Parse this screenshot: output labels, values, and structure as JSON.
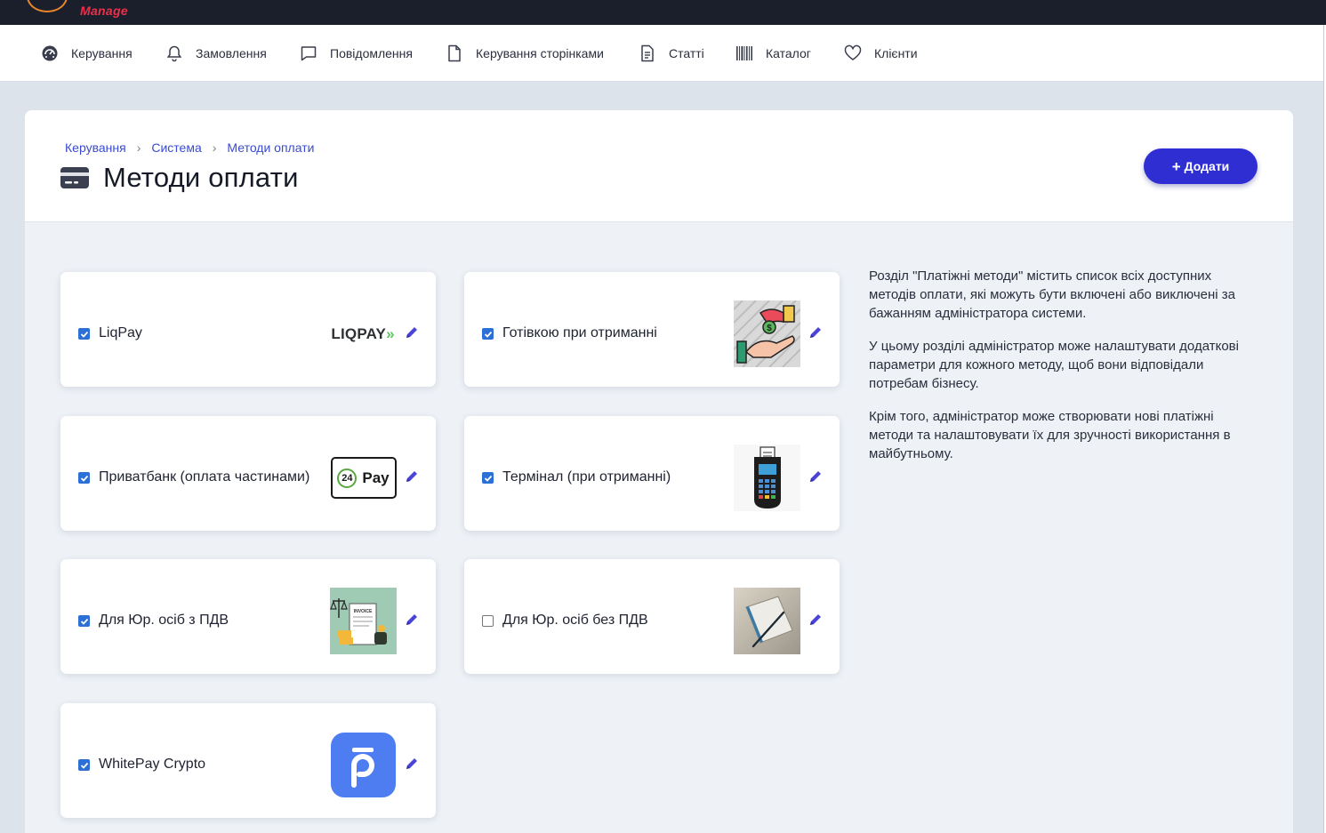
{
  "app": {
    "logo_text": "Manage"
  },
  "nav": {
    "items": [
      {
        "label": "Керування",
        "icon": "dashboard-icon"
      },
      {
        "label": "Замовлення",
        "icon": "bell-icon"
      },
      {
        "label": "Повідомлення",
        "icon": "chat-icon"
      },
      {
        "label": "Керування сторінками",
        "icon": "page-icon"
      },
      {
        "label": "Статті",
        "icon": "article-icon"
      },
      {
        "label": "Каталог",
        "icon": "barcode-icon"
      },
      {
        "label": "Клієнти",
        "icon": "heart-icon"
      }
    ]
  },
  "breadcrumb": {
    "items": [
      "Керування",
      "Система",
      "Методи оплати"
    ]
  },
  "page": {
    "title": "Методи оплати",
    "add_button": "Додати"
  },
  "payment_methods": [
    {
      "label": "LiqPay",
      "checked": true,
      "logo": "liqpay-logo",
      "logo_text": "LIQPAY"
    },
    {
      "label": "Готівкою при отриманні",
      "checked": true,
      "logo": "cash-hand-icon"
    },
    {
      "label": "Приватбанк (оплата частинами)",
      "checked": true,
      "logo": "pay24-logo",
      "logo_text": "Pay",
      "logo_badge": "24"
    },
    {
      "label": "Термінал (при отриманні)",
      "checked": true,
      "logo": "pos-terminal-icon"
    },
    {
      "label": "Для Юр. осіб з ПДВ",
      "checked": true,
      "logo": "invoice-illustration",
      "logo_text": "INVOICE"
    },
    {
      "label": "Для Юр. осіб без ПДВ",
      "checked": false,
      "logo": "notebook-pen-photo"
    },
    {
      "label": "WhitePay Crypto",
      "checked": true,
      "logo": "whitepay-logo"
    }
  ],
  "info": {
    "paragraphs": [
      "Розділ \"Платіжні методи\" містить список всіх доступних методів оплати, які можуть бути включені або виключені за бажанням адміністратора системи.",
      "У цьому розділі адміністратор може налаштувати додаткові параметри для кожного методу, щоб вони відповідали потребам бізнесу.",
      "Крім того, адміністратор може створювати нові платіжні методи та налаштовувати їх для зручності використання в майбутньому."
    ]
  },
  "colors": {
    "accent": "#2f2ed3",
    "link": "#3a4bd1",
    "topbar": "#1b1e2b",
    "logo_red": "#e8324c",
    "logo_orange": "#e7862b"
  }
}
